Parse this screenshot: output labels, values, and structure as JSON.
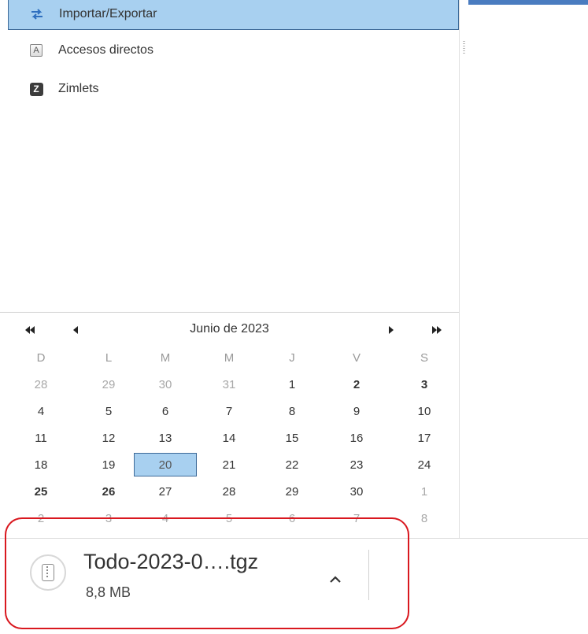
{
  "sidebar": {
    "items": [
      {
        "label": "Importar/Exportar",
        "icon": "import-export-icon",
        "selected": true
      },
      {
        "label": "Accesos directos",
        "icon": "shortcuts-icon"
      },
      {
        "label": "Zimlets",
        "icon": "zimlets-icon"
      }
    ]
  },
  "calendar": {
    "title": "Junio de 2023",
    "weekdays": [
      "D",
      "L",
      "M",
      "M",
      "J",
      "V",
      "S"
    ],
    "weeks": [
      [
        "28",
        "29",
        "30",
        "31",
        "1",
        "2",
        "3"
      ],
      [
        "4",
        "5",
        "6",
        "7",
        "8",
        "9",
        "10"
      ],
      [
        "11",
        "12",
        "13",
        "14",
        "15",
        "16",
        "17"
      ],
      [
        "18",
        "19",
        "20",
        "21",
        "22",
        "23",
        "24"
      ],
      [
        "25",
        "26",
        "27",
        "28",
        "29",
        "30",
        "1"
      ],
      [
        "2",
        "3",
        "4",
        "5",
        "6",
        "7",
        "8"
      ]
    ],
    "today": "20"
  },
  "download": {
    "filename": "Todo-2023-0….tgz",
    "size": "8,8 MB"
  },
  "colors": {
    "selection": "#a8d0f0",
    "selection_border": "#3d6a98",
    "highlight_ring": "#d9181f",
    "top_bar": "#4a7cc0"
  }
}
